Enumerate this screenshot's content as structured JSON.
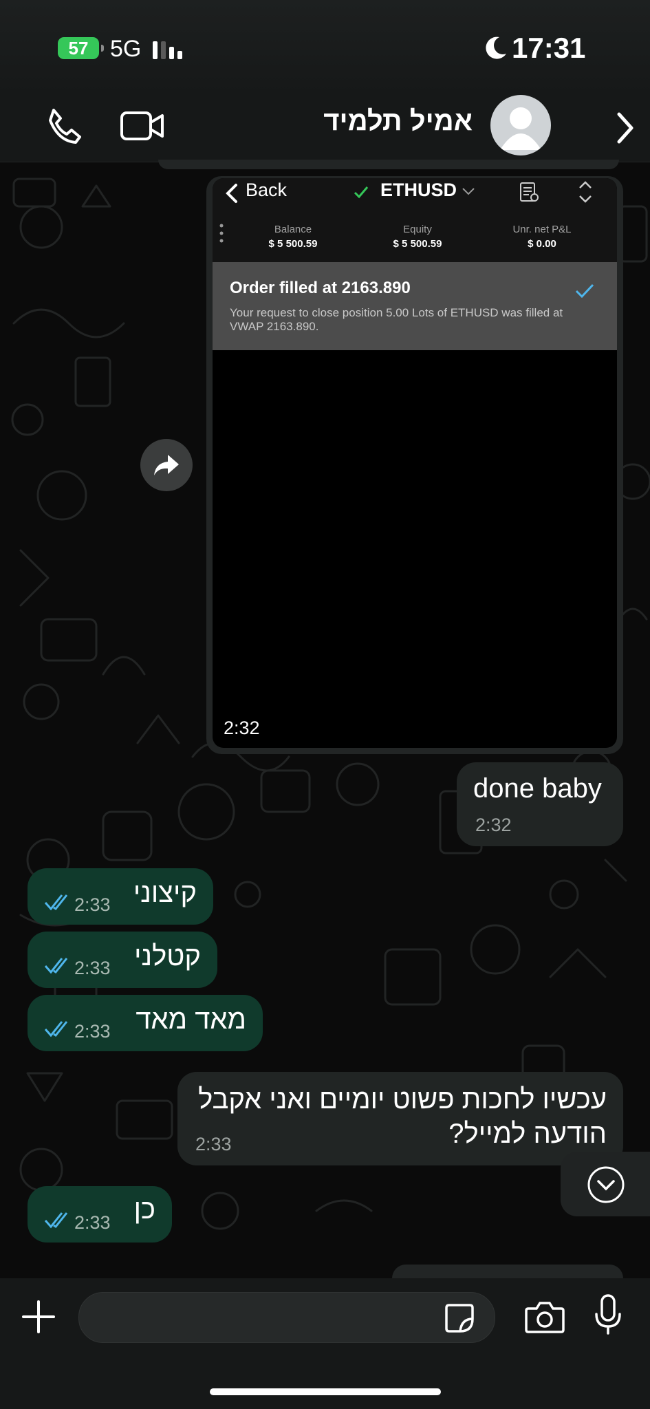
{
  "status": {
    "battery": "57",
    "network": "5G",
    "time": "17:31"
  },
  "header": {
    "contact_name": "אמיל תלמיד"
  },
  "image_message": {
    "back_label": "Back",
    "symbol": "ETHUSD",
    "metrics": [
      {
        "label": "Balance",
        "value": "$ 5 500.59"
      },
      {
        "label": "Equity",
        "value": "$ 5 500.59"
      },
      {
        "label": "Unr. net P&L",
        "value": "$ 0.00"
      }
    ],
    "order_title": "Order filled at 2163.890",
    "order_desc": "Your request to close position 5.00 Lots of ETHUSD was filled at VWAP 2163.890.",
    "time": "2:32"
  },
  "messages": [
    {
      "dir": "in",
      "text": "done baby",
      "time": "2:32"
    },
    {
      "dir": "out",
      "text": "קיצוני",
      "time": "2:33"
    },
    {
      "dir": "out",
      "text": "קטלני",
      "time": "2:33"
    },
    {
      "dir": "out",
      "text": "מאד מאד",
      "time": "2:33"
    },
    {
      "dir": "in",
      "line1": "עכשיו לחכות פשוט יומיים ואני אקבל",
      "line2": "הודעה למייל?",
      "time": "2:33"
    },
    {
      "dir": "out",
      "text": "כן",
      "time": "2:33"
    }
  ],
  "colors": {
    "accent_green": "#35c759",
    "outgoing_bubble": "#103a2c",
    "incoming_bubble": "#212524",
    "read_ticks": "#4fb6ec"
  }
}
